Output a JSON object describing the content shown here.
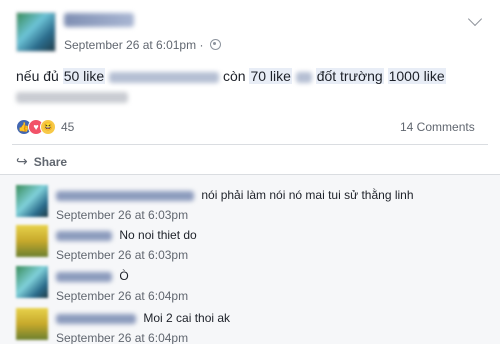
{
  "post": {
    "timestamp": "September 26 at 6:01pm",
    "timestamp_sep": "·",
    "text": {
      "p1": "nếu đủ",
      "p2": "50 like",
      "p3": "còn",
      "p4": "70 like",
      "p5": "đốt trường",
      "p6": "1000 like"
    }
  },
  "reactions": {
    "count": "45",
    "icons": [
      "like-icon",
      "love-icon",
      "haha-icon"
    ],
    "like_glyph": "👍",
    "love_glyph": "♥",
    "haha_glyph": "😆"
  },
  "comments_count": "14 Comments",
  "share": {
    "label": "Share",
    "icon_glyph": "↪"
  },
  "comments": [
    {
      "text": "nói phải làm nói nó mai tui sử thằng linh",
      "time": "September 26 at 6:03pm"
    },
    {
      "text": "No noi thiet do",
      "time": "September 26 at 6:03pm"
    },
    {
      "text": "Ò",
      "time": "September 26 at 6:04pm"
    },
    {
      "text": "Moi 2 cai thoi ak",
      "time": "September 26 at 6:04pm"
    }
  ],
  "colors": {
    "link_highlight": "#e8edf6",
    "secondary_text": "#616770",
    "like_blue": "#4267b2",
    "love_red": "#f25268",
    "haha_yellow": "#f7c948"
  }
}
